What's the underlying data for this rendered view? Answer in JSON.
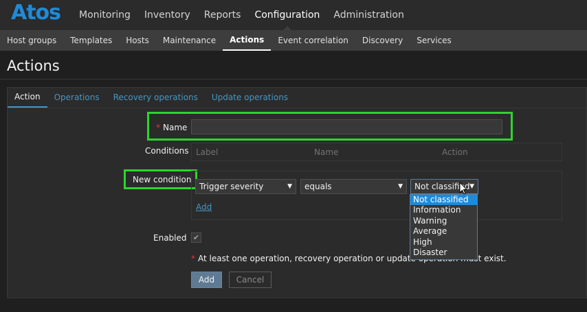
{
  "brand": "Atos",
  "top_nav": [
    {
      "label": "Monitoring"
    },
    {
      "label": "Inventory"
    },
    {
      "label": "Reports"
    },
    {
      "label": "Configuration",
      "active": true
    },
    {
      "label": "Administration"
    }
  ],
  "sub_nav": [
    {
      "label": "Host groups"
    },
    {
      "label": "Templates"
    },
    {
      "label": "Hosts"
    },
    {
      "label": "Maintenance"
    },
    {
      "label": "Actions",
      "active": true
    },
    {
      "label": "Event correlation"
    },
    {
      "label": "Discovery"
    },
    {
      "label": "Services"
    }
  ],
  "page_title": "Actions",
  "tabs": [
    {
      "label": "Action",
      "active": true
    },
    {
      "label": "Operations"
    },
    {
      "label": "Recovery operations"
    },
    {
      "label": "Update operations"
    }
  ],
  "form": {
    "required_mark": "*",
    "name_label": "Name",
    "name_value": "",
    "conditions_label": "Conditions",
    "conditions_columns": [
      "Label",
      "Name",
      "Action"
    ],
    "new_condition_label": "New condition",
    "condition_type": "Trigger severity",
    "condition_operator": "equals",
    "condition_value": "Not classified",
    "add_link": "Add",
    "enabled_label": "Enabled",
    "enabled_checked": true,
    "warning": "At least one operation, recovery operation or update operation must exist.",
    "add_button": "Add",
    "cancel_button": "Cancel"
  },
  "severity_dropdown": {
    "options": [
      "Not classified",
      "Information",
      "Warning",
      "Average",
      "High",
      "Disaster"
    ],
    "selected": "Not classified"
  },
  "colors": {
    "highlight": "#2dd52d",
    "accent": "#1f8ad8",
    "link": "#4796c4"
  }
}
